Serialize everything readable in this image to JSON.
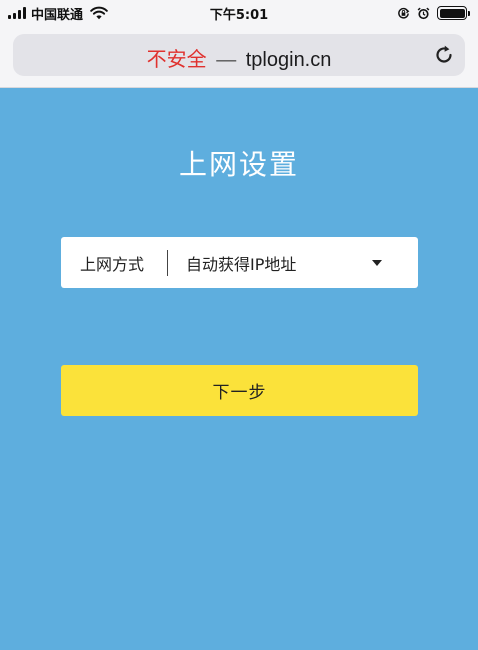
{
  "status_bar": {
    "carrier": "中国联通",
    "time": "下午5:01",
    "signal_icon": "signal-bars-icon",
    "wifi_icon": "wifi-icon",
    "battery_level": 1.0
  },
  "browser": {
    "security_label": "不安全",
    "separator": "—",
    "url": "tplogin.cn",
    "reload_icon": "reload-icon",
    "security_color": "#e0312e"
  },
  "page": {
    "title": "上网设置",
    "connection_field": {
      "label": "上网方式",
      "selected_value": "自动获得IP地址"
    },
    "next_button_label": "下一步",
    "background_color": "#5eaede",
    "button_color": "#fbe23a"
  }
}
